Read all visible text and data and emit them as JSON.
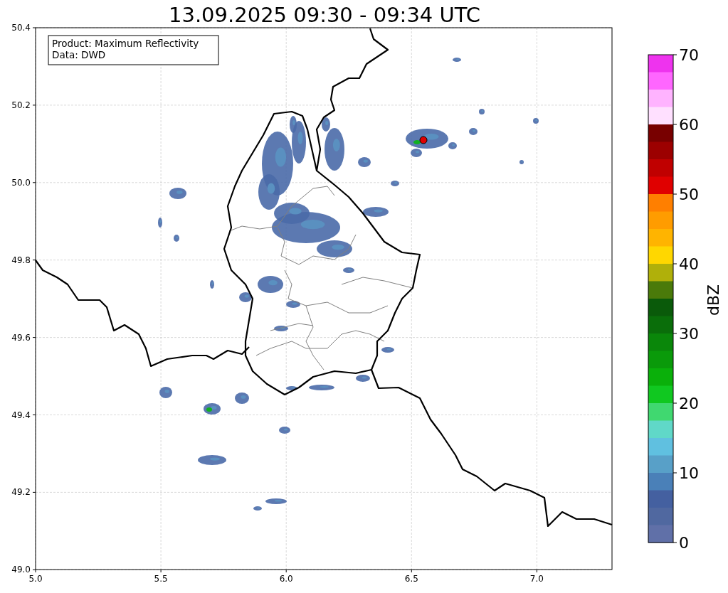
{
  "title": "13.09.2025 09:30 - 09:34 UTC",
  "info_box": [
    "Product: Maximum Reflectivity",
    "Data: DWD"
  ],
  "map": {
    "x_ticks": [
      "5.0",
      "5.5",
      "6.0",
      "6.5",
      "7.0"
    ],
    "y_ticks": [
      "50.4",
      "50.2",
      "50.0",
      "49.8",
      "49.6",
      "49.4",
      "49.2",
      "49.0"
    ]
  },
  "colorbar": {
    "label": "dBZ",
    "ticks": [
      "70",
      "60",
      "50",
      "40",
      "30",
      "20",
      "10",
      "0"
    ],
    "segments": [
      {
        "color": "#ee33ee"
      },
      {
        "color": "#ff66ff"
      },
      {
        "color": "#ffb3ff"
      },
      {
        "color": "#ffe0ff"
      },
      {
        "color": "#780000"
      },
      {
        "color": "#9c0000"
      },
      {
        "color": "#c00000"
      },
      {
        "color": "#e00000"
      },
      {
        "color": "#ff7f00"
      },
      {
        "color": "#ff9c00"
      },
      {
        "color": "#ffb400"
      },
      {
        "color": "#ffd700"
      },
      {
        "color": "#b0b00a"
      },
      {
        "color": "#4a7a0a"
      },
      {
        "color": "#0a5a0a"
      },
      {
        "color": "#0a6e0a"
      },
      {
        "color": "#0a870a"
      },
      {
        "color": "#0a9a0a"
      },
      {
        "color": "#0ab00a"
      },
      {
        "color": "#10c820"
      },
      {
        "color": "#40d870"
      },
      {
        "color": "#60d8c8"
      },
      {
        "color": "#60c0e0"
      },
      {
        "color": "#58a0c8"
      },
      {
        "color": "#4a80b8"
      },
      {
        "color": "#4460a0"
      },
      {
        "color": "#5068a0"
      },
      {
        "color": "#6070a8"
      }
    ]
  }
}
